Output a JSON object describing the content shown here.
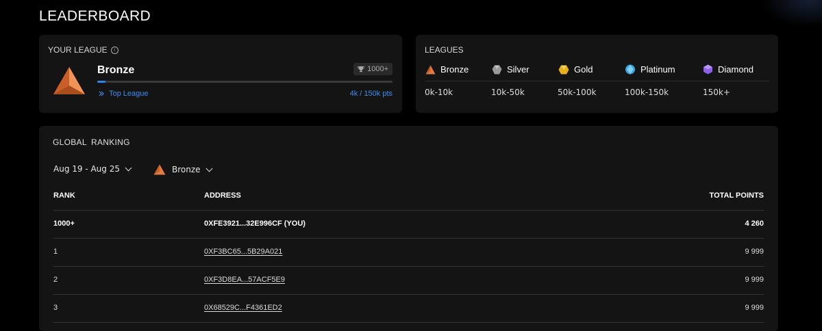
{
  "page": {
    "title": "LEADERBOARD"
  },
  "your_league": {
    "title": "YOUR LEAGUE",
    "league_name": "Bronze",
    "points_badge": "1000+",
    "progress_fraction": 0.027,
    "top_league_link": "Top League",
    "points_text": "4k / 150k pts"
  },
  "leagues": {
    "title": "LEAGUES",
    "items": [
      {
        "name": "Bronze",
        "range": "0k-10k",
        "icon": "bronze-pyramid-icon",
        "color": "#d9743c"
      },
      {
        "name": "Silver",
        "range": "10k-50k",
        "icon": "silver-gem-icon",
        "color": "#a9a9a9"
      },
      {
        "name": "Gold",
        "range": "50k-100k",
        "icon": "gold-gem-icon",
        "color": "#e8b420"
      },
      {
        "name": "Platinum",
        "range": "100k-150k",
        "icon": "platinum-gem-icon",
        "color": "#3fa9e0"
      },
      {
        "name": "Diamond",
        "range": "150k+",
        "icon": "diamond-gem-icon",
        "color": "#9b6cf0"
      }
    ]
  },
  "global_ranking": {
    "title": "GLOBAL RANKING",
    "date_filter": "Aug 19 - Aug 25",
    "league_filter": "Bronze",
    "columns": {
      "rank": "RANK",
      "address": "ADDRESS",
      "total_points": "TOTAL POINTS"
    },
    "rows": [
      {
        "rank": "1000+",
        "address": "0XFE3921...32E996CF (YOU)",
        "points": "4 260",
        "is_you": true
      },
      {
        "rank": "1",
        "address": "0XF3BC65...5B29A021",
        "points": "9 999",
        "is_you": false
      },
      {
        "rank": "2",
        "address": "0XF3D8EA...57ACF5E9",
        "points": "9 999",
        "is_you": false
      },
      {
        "rank": "3",
        "address": "0X68529C...F4361ED2",
        "points": "9 999",
        "is_you": false
      }
    ]
  },
  "colors": {
    "accent": "#2b86f0",
    "bronze": "#d9743c",
    "card_bg": "#141414",
    "page_bg": "#000000"
  }
}
